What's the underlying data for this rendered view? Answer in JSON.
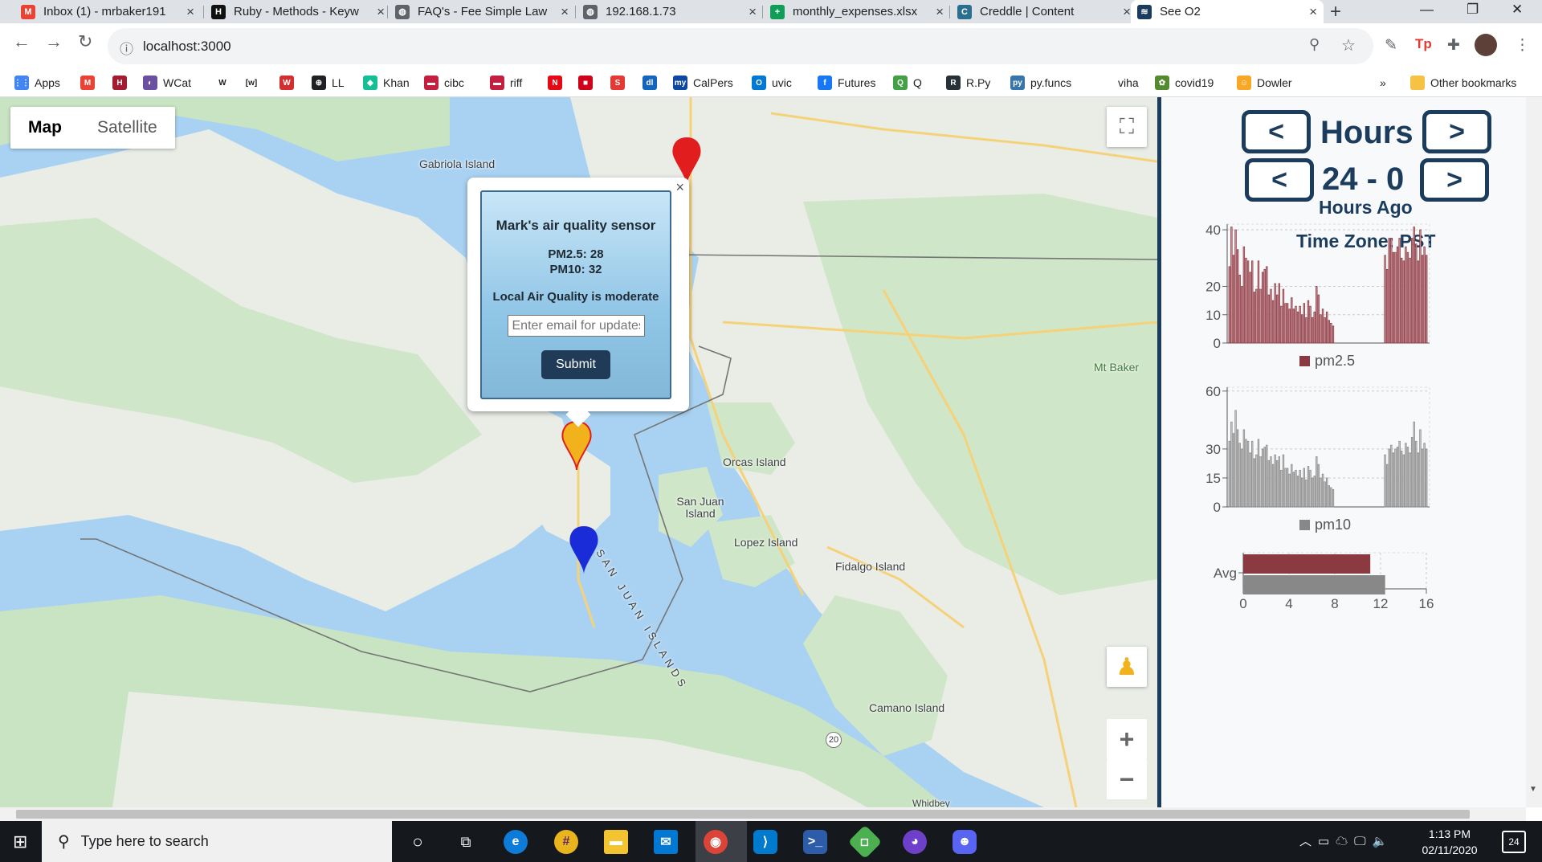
{
  "browser": {
    "tabs": [
      {
        "title": "Inbox (1) - mrbaker191",
        "icon": "gmail-icon",
        "color": "#ea4335",
        "glyph": "M"
      },
      {
        "title": "Ruby - Methods - Keyw",
        "icon": "tutorialspoint-icon",
        "color": "#111111",
        "glyph": "H"
      },
      {
        "title": "FAQ's - Fee Simple Law",
        "icon": "globe-icon",
        "color": "#5f6368",
        "glyph": "◍"
      },
      {
        "title": "192.168.1.73",
        "icon": "globe-icon",
        "color": "#5f6368",
        "glyph": "◍"
      },
      {
        "title": "monthly_expenses.xlsx",
        "icon": "sheets-icon",
        "color": "#0f9d58",
        "glyph": "+"
      },
      {
        "title": "Creddle | Content",
        "icon": "creddle-icon",
        "color": "#2b6f8e",
        "glyph": "C"
      },
      {
        "title": "See O2",
        "icon": "see-o2-icon",
        "color": "#1c3c5e",
        "glyph": "≋"
      }
    ],
    "url": "localhost:3000",
    "bookmarks": [
      {
        "label": "Apps",
        "icon": "apps-icon",
        "color": "#4285f4",
        "glyph": "⋮⋮"
      },
      {
        "label": "",
        "icon": "gmail-icon",
        "color": "#ea4335",
        "glyph": "M"
      },
      {
        "label": "",
        "icon": "harvard-icon",
        "color": "#a51c30",
        "glyph": "H"
      },
      {
        "label": "WCat",
        "icon": "worldcat-icon",
        "color": "#6b4fa0",
        "glyph": "◐"
      },
      {
        "label": "",
        "icon": "wikipedia-icon",
        "color": "#ffffff",
        "glyph": "W"
      },
      {
        "label": "",
        "icon": "wiktionary-icon",
        "color": "#ffffff",
        "glyph": "[w]"
      },
      {
        "label": "",
        "icon": "wolfram-icon",
        "color": "#d32f2f",
        "glyph": "W"
      },
      {
        "label": "LL",
        "icon": "ll-icon",
        "color": "#202124",
        "glyph": "⊕"
      },
      {
        "label": "Khan",
        "icon": "khan-icon",
        "color": "#14bf96",
        "glyph": "◆"
      },
      {
        "label": "cibc",
        "icon": "cibc-icon",
        "color": "#c41f3e",
        "glyph": "▬"
      },
      {
        "label": "riff",
        "icon": "riff-icon",
        "color": "#c41f3e",
        "glyph": "▬"
      },
      {
        "label": "",
        "icon": "netflix-icon",
        "color": "#e50914",
        "glyph": "N"
      },
      {
        "label": "",
        "icon": "red-square-icon",
        "color": "#d0021b",
        "glyph": "■"
      },
      {
        "label": "",
        "icon": "spiral-icon",
        "color": "#e53935",
        "glyph": "S"
      },
      {
        "label": "",
        "icon": "dl-icon",
        "color": "#1565c0",
        "glyph": "dl"
      },
      {
        "label": "CalPers",
        "icon": "calpers-icon",
        "color": "#0d47a1",
        "glyph": "my"
      },
      {
        "label": "uvic",
        "icon": "outlook-icon",
        "color": "#0078d4",
        "glyph": "O"
      },
      {
        "label": "Futures",
        "icon": "facebook-icon",
        "color": "#1877f2",
        "glyph": "f"
      },
      {
        "label": "Q",
        "icon": "q-icon",
        "color": "#43a047",
        "glyph": "Q"
      },
      {
        "label": "R.Py",
        "icon": "rpy-icon",
        "color": "#263238",
        "glyph": "R"
      },
      {
        "label": "py.funcs",
        "icon": "python-icon",
        "color": "#3776ab",
        "glyph": "py"
      },
      {
        "label": "viha",
        "icon": "viha-icon",
        "color": "#ffffff",
        "glyph": ""
      },
      {
        "label": "covid19",
        "icon": "covid-icon",
        "color": "#558b2f",
        "glyph": "✿"
      },
      {
        "label": "Dowler",
        "icon": "dowler-icon",
        "color": "#f9a825",
        "glyph": "☺"
      },
      {
        "label": "»",
        "icon": "more-bookmarks-icon",
        "color": "#ffffff",
        "glyph": ""
      },
      {
        "label": "Other bookmarks",
        "icon": "folder-icon",
        "color": "#f6c244",
        "glyph": ""
      }
    ]
  },
  "map": {
    "type_control": {
      "map": "Map",
      "satellite": "Satellite"
    },
    "places": [
      "Gabriola Island",
      "Orcas Island",
      "San Juan Island",
      "Lopez Island",
      "Fidalgo Island",
      "Camano Island",
      "Mt Baker",
      "SAN JUAN ISLANDS",
      "Whidbey",
      "20"
    ],
    "info": {
      "title": "Mark's air quality sensor",
      "pm25": "PM2.5: 28",
      "pm10": "PM10: 32",
      "quality": "Local Air Quality is moderate",
      "email_placeholder": "Enter email for updates",
      "submit": "Submit",
      "close": "×"
    },
    "colors": {
      "water": "#a9d2f2",
      "land": "#e9ede6",
      "park": "#c8e4c2",
      "marker_red": "#e21d1d",
      "marker_blue": "#1a2bd8",
      "marker_yellow": "#f2b21b"
    }
  },
  "panel": {
    "hours_prev": "<",
    "hours_label": "Hours",
    "hours_next": ">",
    "range_prev": "<",
    "range_label": "24 - 0",
    "range_next": ">",
    "hours_ago": "Hours Ago",
    "timezone": "Time Zone: PST",
    "colors": {
      "pm25": "#8b3a42",
      "pm10": "#888888",
      "navy": "#1c3c5e"
    }
  },
  "chart_data": [
    {
      "type": "bar",
      "series": [
        {
          "name": "pm2.5",
          "values": [
            27,
            41,
            31,
            40,
            33,
            24,
            20,
            34,
            30,
            29,
            25,
            29,
            18,
            19,
            29,
            19,
            25,
            26,
            27,
            17,
            19,
            15,
            21,
            17,
            21,
            13,
            19,
            14,
            14,
            12,
            16,
            12,
            13,
            11,
            13,
            10,
            14,
            9,
            15,
            13,
            9,
            11,
            20,
            17,
            10,
            12,
            9,
            11,
            8,
            7,
            6,
            0,
            0,
            0,
            0,
            0,
            0,
            0,
            0,
            0,
            0,
            0,
            0,
            0,
            0,
            0,
            0,
            0,
            0,
            0,
            0,
            0,
            0,
            0,
            0,
            31,
            26,
            37,
            37,
            32,
            32,
            34,
            37,
            30,
            29,
            34,
            32,
            30,
            37,
            41,
            35,
            29,
            40,
            31,
            34,
            31
          ]
        }
      ],
      "yticks": [
        0,
        10,
        20,
        40
      ],
      "ylim": [
        0,
        42
      ],
      "legend": "pm2.5"
    },
    {
      "type": "bar",
      "series": [
        {
          "name": "pm10",
          "values": [
            34,
            44,
            38,
            50,
            40,
            33,
            30,
            40,
            35,
            34,
            28,
            34,
            25,
            27,
            35,
            26,
            30,
            31,
            32,
            24,
            26,
            22,
            27,
            24,
            26,
            19,
            27,
            20,
            20,
            17,
            22,
            18,
            19,
            16,
            19,
            15,
            20,
            14,
            21,
            19,
            15,
            16,
            26,
            22,
            15,
            17,
            13,
            15,
            11,
            10,
            9,
            0,
            0,
            0,
            0,
            0,
            0,
            0,
            0,
            0,
            0,
            0,
            0,
            0,
            0,
            0,
            0,
            0,
            0,
            0,
            0,
            0,
            0,
            0,
            0,
            27,
            22,
            30,
            32,
            28,
            30,
            31,
            34,
            29,
            27,
            33,
            31,
            28,
            36,
            44,
            34,
            28,
            40,
            30,
            33,
            30
          ]
        }
      ],
      "yticks": [
        0,
        15,
        30,
        60
      ],
      "ylim": [
        0,
        62
      ],
      "legend": "pm10"
    },
    {
      "type": "bar",
      "orientation": "horizontal",
      "categories": [
        "Avg"
      ],
      "series": [
        {
          "name": "pm2.5",
          "values": [
            11.1
          ]
        },
        {
          "name": "pm10",
          "values": [
            12.4
          ]
        }
      ],
      "xticks": [
        0,
        4,
        8,
        12,
        16
      ],
      "xlim": [
        0,
        16
      ]
    }
  ],
  "taskbar": {
    "search_placeholder": "Type here to search",
    "time": "1:13 PM",
    "date": "02/11/2020",
    "notifications": "24"
  }
}
